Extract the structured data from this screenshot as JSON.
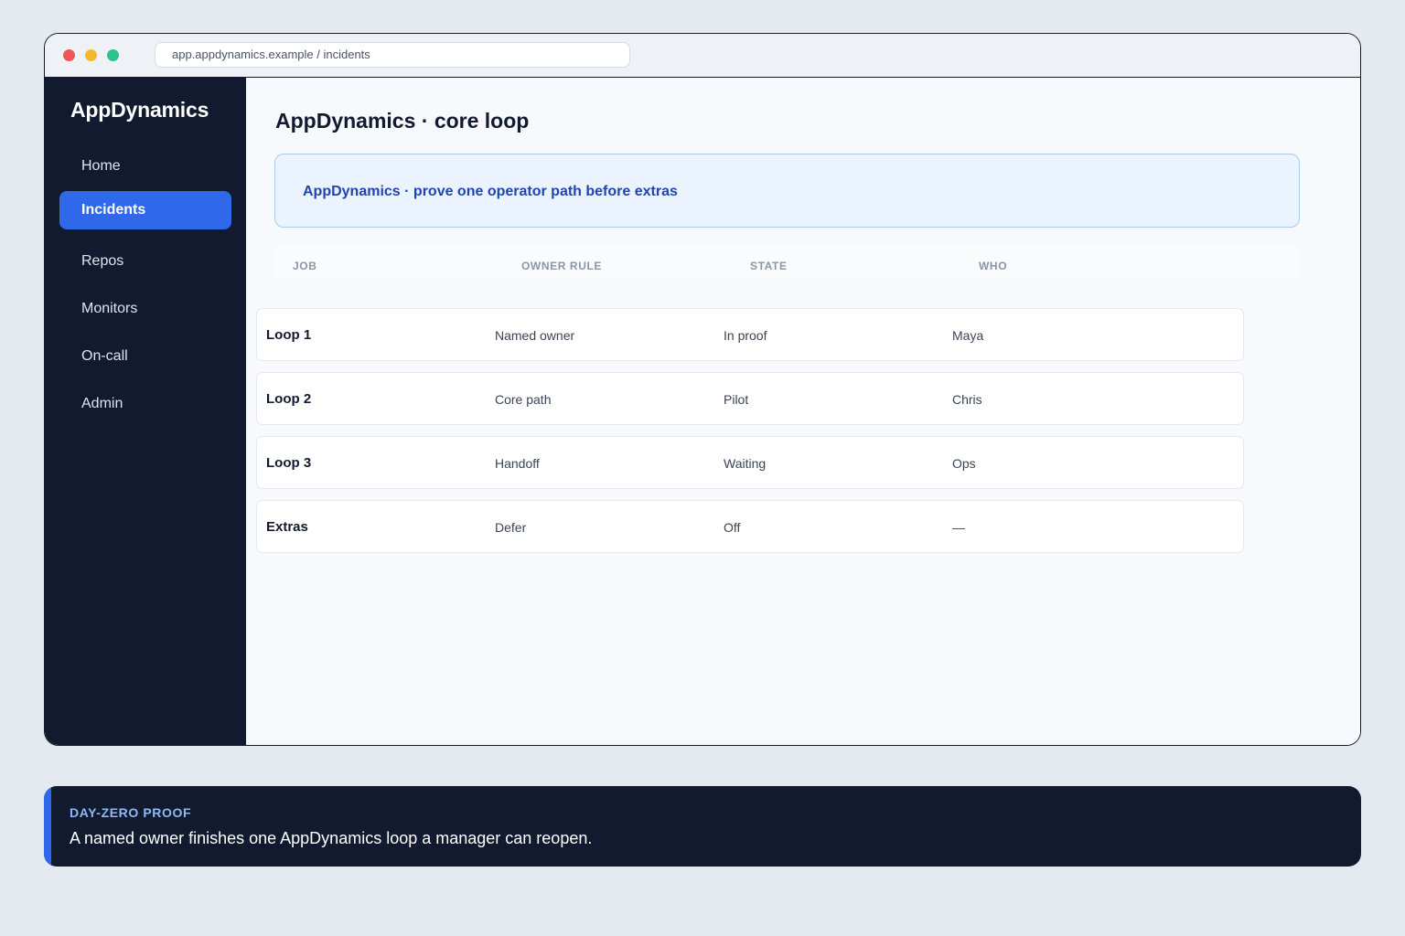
{
  "browser": {
    "url": "app.appdynamics.example / incidents"
  },
  "sidebar": {
    "brand": "AppDynamics",
    "items": [
      {
        "label": "Home",
        "active": false
      },
      {
        "label": "Incidents",
        "active": true
      },
      {
        "label": "Repos",
        "active": false
      },
      {
        "label": "Monitors",
        "active": false
      },
      {
        "label": "On-call",
        "active": false
      },
      {
        "label": "Admin",
        "active": false
      }
    ]
  },
  "main": {
    "title": "AppDynamics · core loop",
    "banner": "AppDynamics · prove one operator path before extras",
    "table": {
      "headers": [
        "JOB",
        "OWNER RULE",
        "STATE",
        "WHO"
      ],
      "rows": [
        {
          "job": "Loop 1",
          "owner": "Named owner",
          "state": "In proof",
          "who": "Maya"
        },
        {
          "job": "Loop 2",
          "owner": "Core path",
          "state": "Pilot",
          "who": "Chris"
        },
        {
          "job": "Loop 3",
          "owner": "Handoff",
          "state": "Waiting",
          "who": "Ops"
        },
        {
          "job": "Extras",
          "owner": "Defer",
          "state": "Off",
          "who": "—"
        }
      ]
    }
  },
  "callout": {
    "kicker": "DAY-ZERO PROOF",
    "text": "A named owner finishes one AppDynamics loop a manager can reopen."
  },
  "colors": {
    "accent": "#2f68eb",
    "sidebar_bg": "#111a2e",
    "banner_bg": "#eaf3ff",
    "banner_text": "#1f45b0"
  }
}
